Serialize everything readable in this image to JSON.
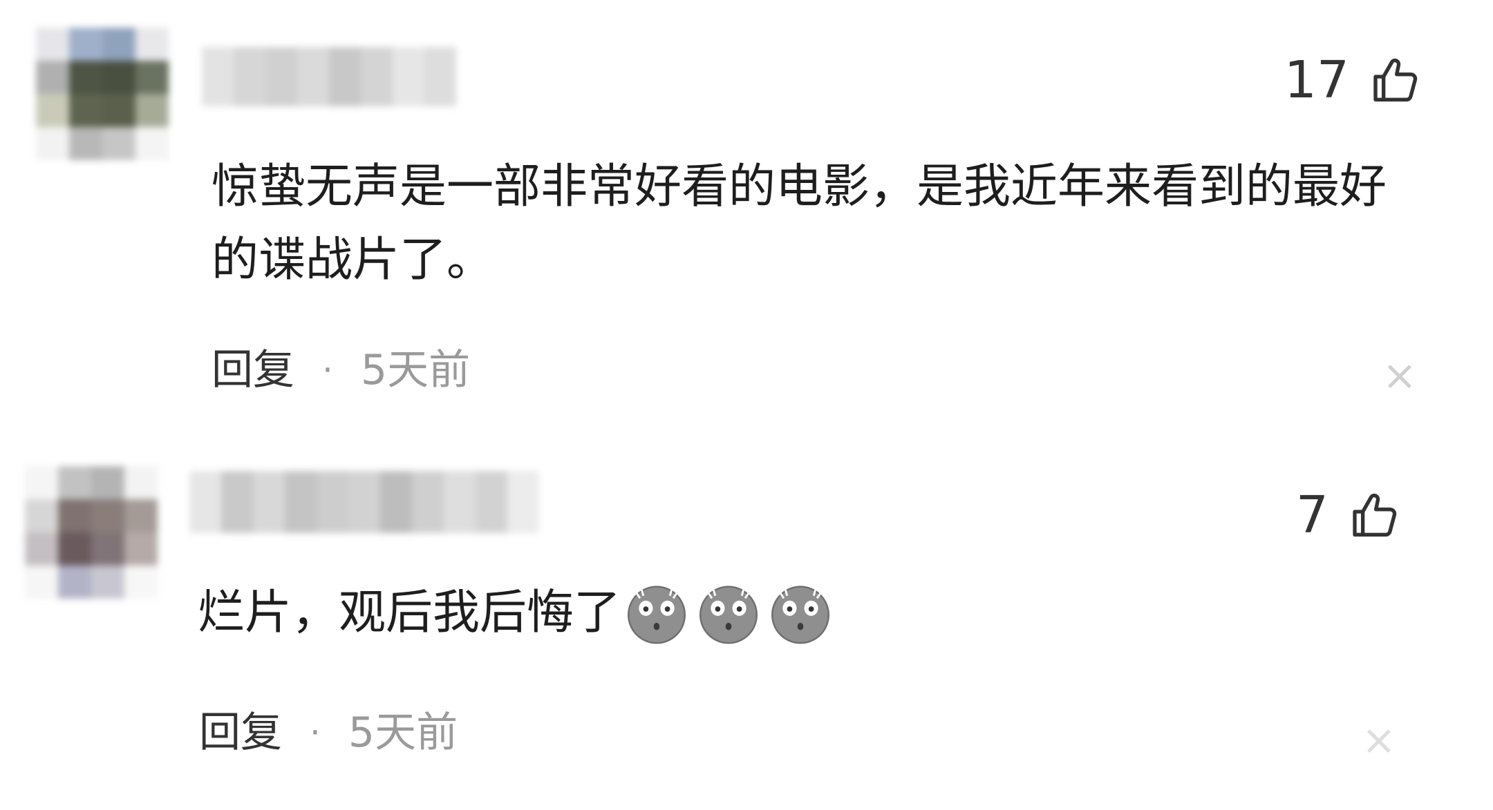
{
  "comments": [
    {
      "avatar_colors": [
        "#e6e6ea",
        "#9fb0cb",
        "#90a3bd",
        "#e8e8ea",
        "#b0b0b0",
        "#4e5544",
        "#4a5040",
        "#6a7260",
        "#c9cbb8",
        "#5e6450",
        "#5a604c",
        "#a6ab98",
        "#f2f2f2",
        "#b8b8b8",
        "#c6c6c6",
        "#f4f4f4"
      ],
      "username_colors": [
        "#e3e3e3",
        "#d6d6d6",
        "#d0d0d0",
        "#dadada",
        "#c8c8c8",
        "#d4d4d4",
        "#e6e6e6",
        "#dddddd"
      ],
      "like_count": "17",
      "like_icon": "thumbs-up-icon",
      "text": "惊蛰无声是一部非常好看的电影，是我近年来看到的最好的谍战片了。",
      "emojis": [],
      "reply_label": "回复",
      "separator": "·",
      "time": "5天前",
      "close_icon": "close-icon",
      "close_glyph": "×"
    },
    {
      "avatar_colors": [
        "#f5f5f5",
        "#c2c2c2",
        "#b4b4b4",
        "#f3f3f3",
        "#d6d6d6",
        "#7f7270",
        "#8a7d7a",
        "#a49a96",
        "#c4bfc2",
        "#6a5a5e",
        "#807478",
        "#b5aaa8",
        "#f6f6f6",
        "#b3b3c8",
        "#c8c6d0",
        "#f7f7f7"
      ],
      "username_colors": [
        "#e6e6e6",
        "#c9c9c9",
        "#d8d8d8",
        "#c4c4c4",
        "#cdcdcd",
        "#d2d2d2",
        "#bdbdbd",
        "#cfcfcf",
        "#dedede",
        "#d2d2d2",
        "#ececec"
      ],
      "like_count": "7",
      "like_icon": "thumbs-up-icon",
      "text": "烂片，观后我后悔了",
      "emojis": [
        "shocked-face-emoji",
        "shocked-face-emoji",
        "shocked-face-emoji"
      ],
      "reply_label": "回复",
      "separator": "·",
      "time": "5天前",
      "close_icon": "close-icon",
      "close_glyph": "×"
    }
  ]
}
